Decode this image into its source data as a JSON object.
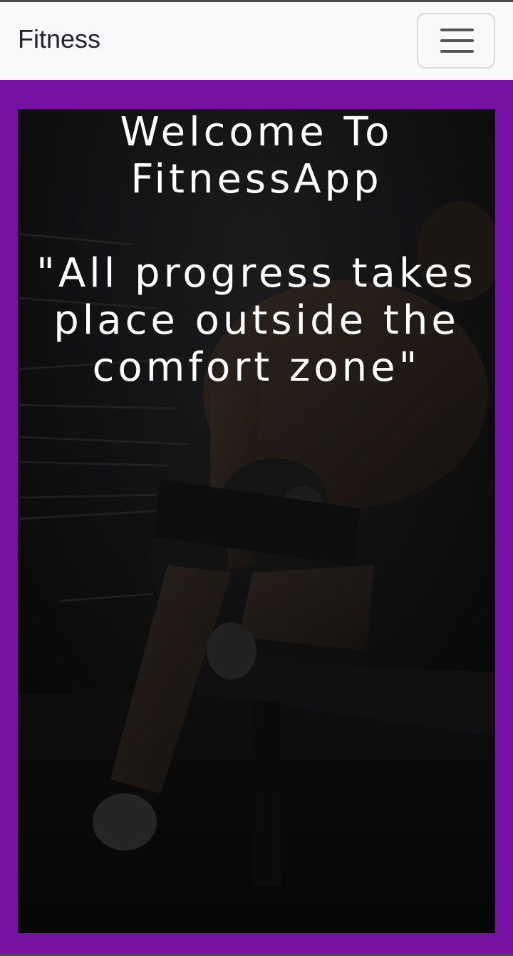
{
  "navbar": {
    "brand": "Fitness",
    "menu_toggle_icon": "hamburger-menu-icon"
  },
  "hero": {
    "background_image": "gym-man-lifting-dumbbell-photo",
    "welcome_line1": "Welcome To",
    "welcome_line2": "FitnessApp",
    "quote_line1": "\"All progress takes",
    "quote_line2": "place outside the",
    "quote_line3": "comfort zone\""
  },
  "colors": {
    "navbar_bg": "#f8f9fa",
    "page_bg": "#7611a3",
    "hero_text": "#ffffff",
    "brand_text": "#212529"
  }
}
